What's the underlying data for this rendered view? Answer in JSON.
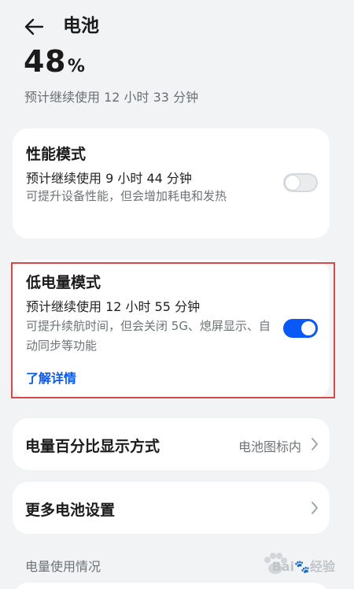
{
  "header": {
    "title": "电池",
    "back_icon": "arrow-left-icon"
  },
  "battery": {
    "level": "48",
    "unit": "%",
    "estimate": "预计继续使用 12 小时 33 分钟"
  },
  "performance_mode": {
    "title": "性能模式",
    "estimate": "预计继续使用 9 小时 44 分钟",
    "description": "可提升设备性能，但会增加耗电和发热",
    "enabled": false
  },
  "low_power_mode": {
    "title": "低电量模式",
    "estimate": "预计继续使用 12 小时 55 分钟",
    "description": "可提升续航时间，但会关闭 5G、熄屏显示、自动同步等功能",
    "link": "了解详情",
    "enabled": true
  },
  "percentage_display": {
    "label": "电量百分比显示方式",
    "value": "电池图标内"
  },
  "more_settings": {
    "label": "更多电池设置"
  },
  "usage_section": {
    "label": "电量使用情况"
  },
  "watermark": {
    "text": "Bai🐾经验"
  },
  "colors": {
    "accent": "#0a59f7",
    "highlight": "#d94848",
    "background": "#f1f3f5"
  }
}
